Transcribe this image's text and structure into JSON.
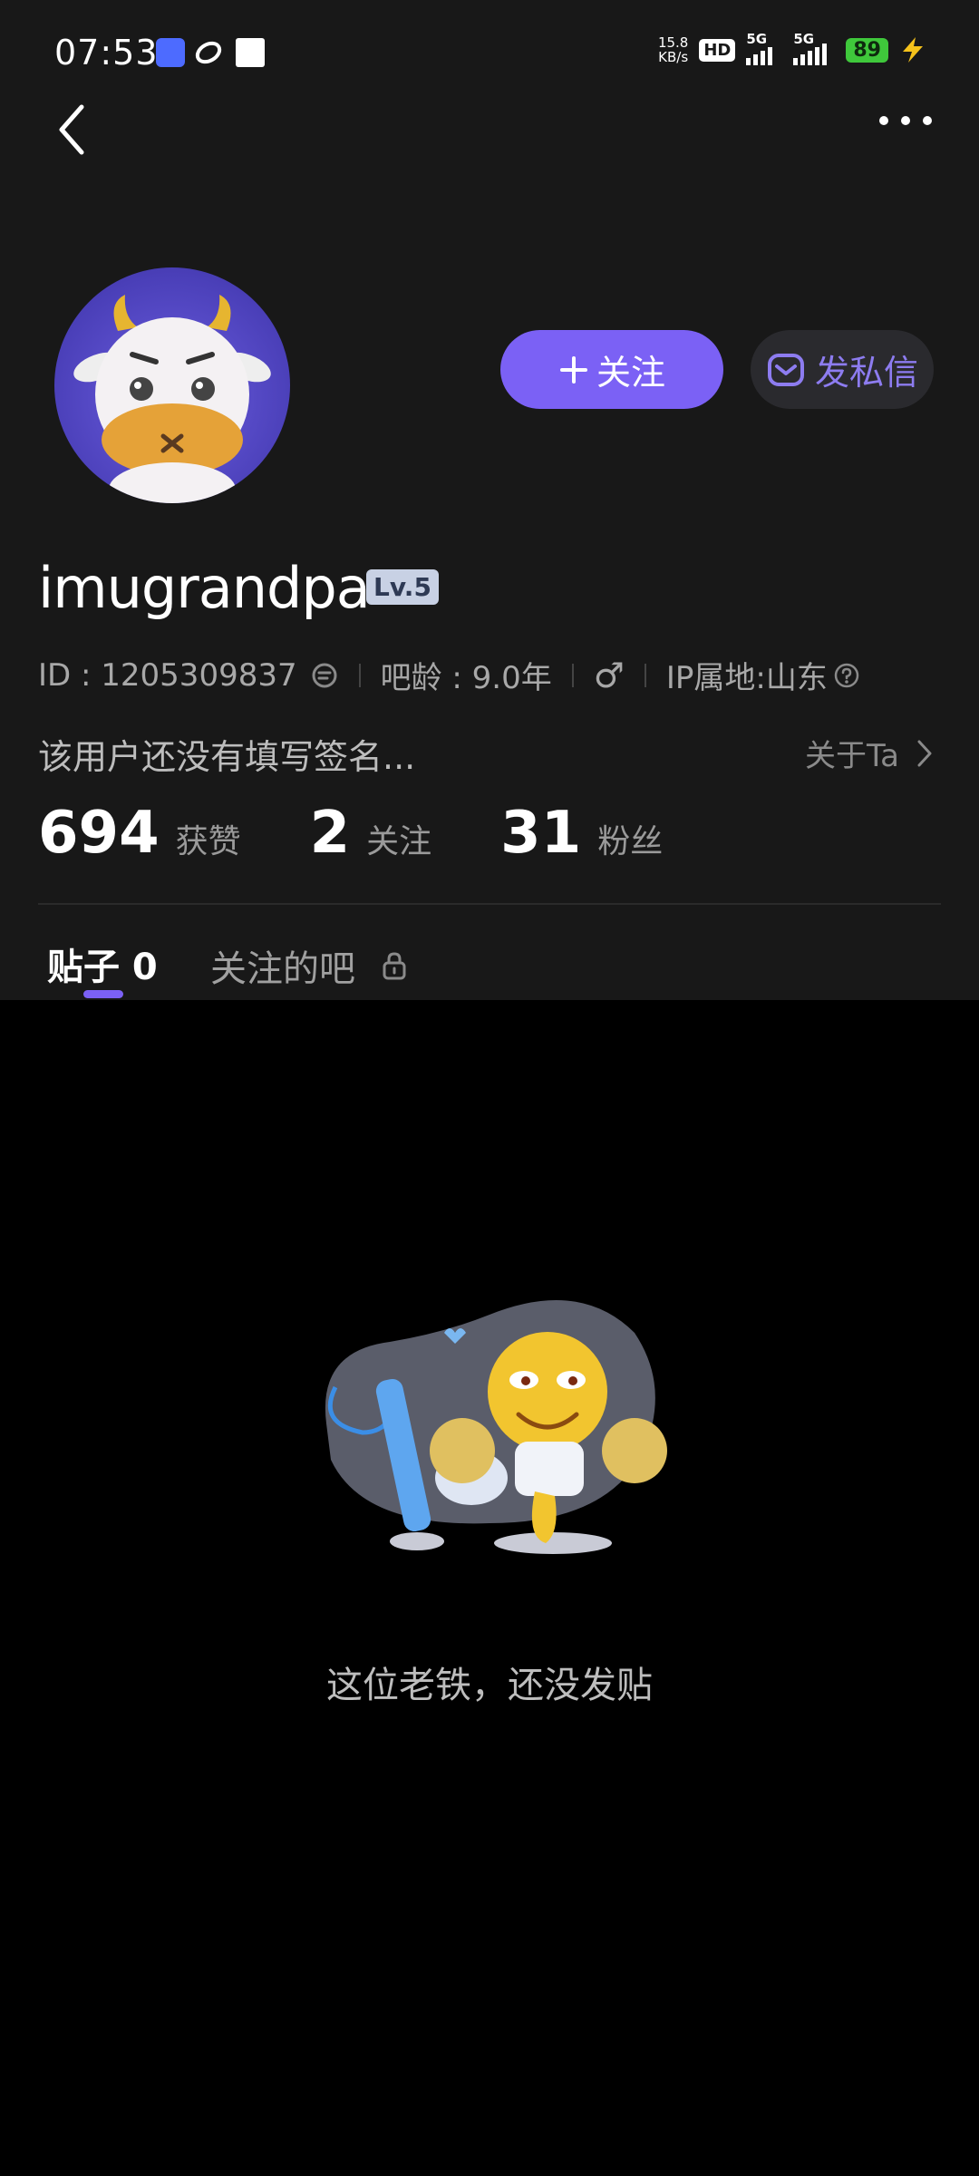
{
  "status_bar": {
    "time": "07:53",
    "net_speed_value": "15.8",
    "net_speed_unit": "KB/s",
    "hd_label": "HD",
    "signal1_label": "5G",
    "signal2_label": "5G",
    "battery": "89",
    "icons": [
      "tieba-app-icon",
      "planet-icon",
      "white-square-icon",
      "charging-bolt-icon"
    ]
  },
  "header": {
    "back_icon": "chevron-left-icon",
    "more_icon": "more-dots-icon"
  },
  "profile": {
    "username": "imugrandpa",
    "level": "Lv.5",
    "id_text": "ID : 1205309837",
    "bar_age": "吧龄 : 9.0年",
    "gender_symbol": "♂",
    "ip_location": "IP属地:山东",
    "signature": "该用户还没有填写签名...",
    "about_link": "关于Ta"
  },
  "actions": {
    "follow_label": "关注",
    "follow_icon": "plus-icon",
    "message_label": "发私信",
    "message_icon": "mail-icon"
  },
  "stats": [
    {
      "value": "694",
      "label": "获赞"
    },
    {
      "value": "2",
      "label": "关注"
    },
    {
      "value": "31",
      "label": "粉丝"
    }
  ],
  "tabs": [
    {
      "label": "贴子 0",
      "active": true
    },
    {
      "label": "关注的吧",
      "locked": true
    }
  ],
  "empty_state": {
    "message": "这位老铁，还没发贴"
  },
  "colors": {
    "accent": "#7b61f5",
    "header_bg": "#181818",
    "body_bg": "#000000"
  }
}
